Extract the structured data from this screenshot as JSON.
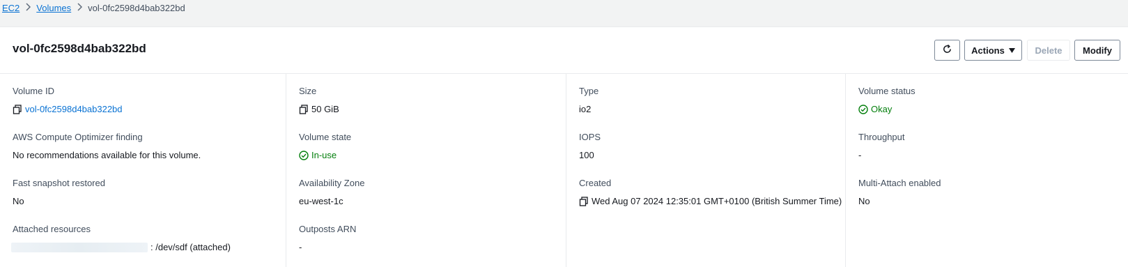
{
  "breadcrumb": {
    "ec2": "EC2",
    "volumes": "Volumes",
    "current": "vol-0fc2598d4bab322bd"
  },
  "header": {
    "title": "vol-0fc2598d4bab322bd",
    "actions_label": "Actions",
    "delete_label": "Delete",
    "modify_label": "Modify"
  },
  "details": {
    "volume_id": {
      "label": "Volume ID",
      "value": "vol-0fc2598d4bab322bd"
    },
    "size": {
      "label": "Size",
      "value": "50 GiB"
    },
    "type": {
      "label": "Type",
      "value": "io2"
    },
    "volume_status": {
      "label": "Volume status",
      "value": "Okay"
    },
    "optimizer": {
      "label": "AWS Compute Optimizer finding",
      "value": "No recommendations available for this volume."
    },
    "volume_state": {
      "label": "Volume state",
      "value": "In-use"
    },
    "iops": {
      "label": "IOPS",
      "value": "100"
    },
    "throughput": {
      "label": "Throughput",
      "value": "-"
    },
    "fast_snapshot": {
      "label": "Fast snapshot restored",
      "value": "No"
    },
    "availability_zone": {
      "label": "Availability Zone",
      "value": "eu-west-1c"
    },
    "created": {
      "label": "Created",
      "value": "Wed Aug 07 2024 12:35:01 GMT+0100 (British Summer Time)"
    },
    "multi_attach": {
      "label": "Multi-Attach enabled",
      "value": "No"
    },
    "attached": {
      "label": "Attached resources",
      "value": ": /dev/sdf (attached)"
    },
    "outposts_arn": {
      "label": "Outposts ARN",
      "value": "-"
    }
  },
  "colors": {
    "link": "#0972d3",
    "success": "#037f0c",
    "border": "#e9ebed"
  },
  "icons": [
    "chevron-right-icon",
    "refresh-icon",
    "caret-down-icon",
    "copy-icon",
    "status-success-icon"
  ]
}
